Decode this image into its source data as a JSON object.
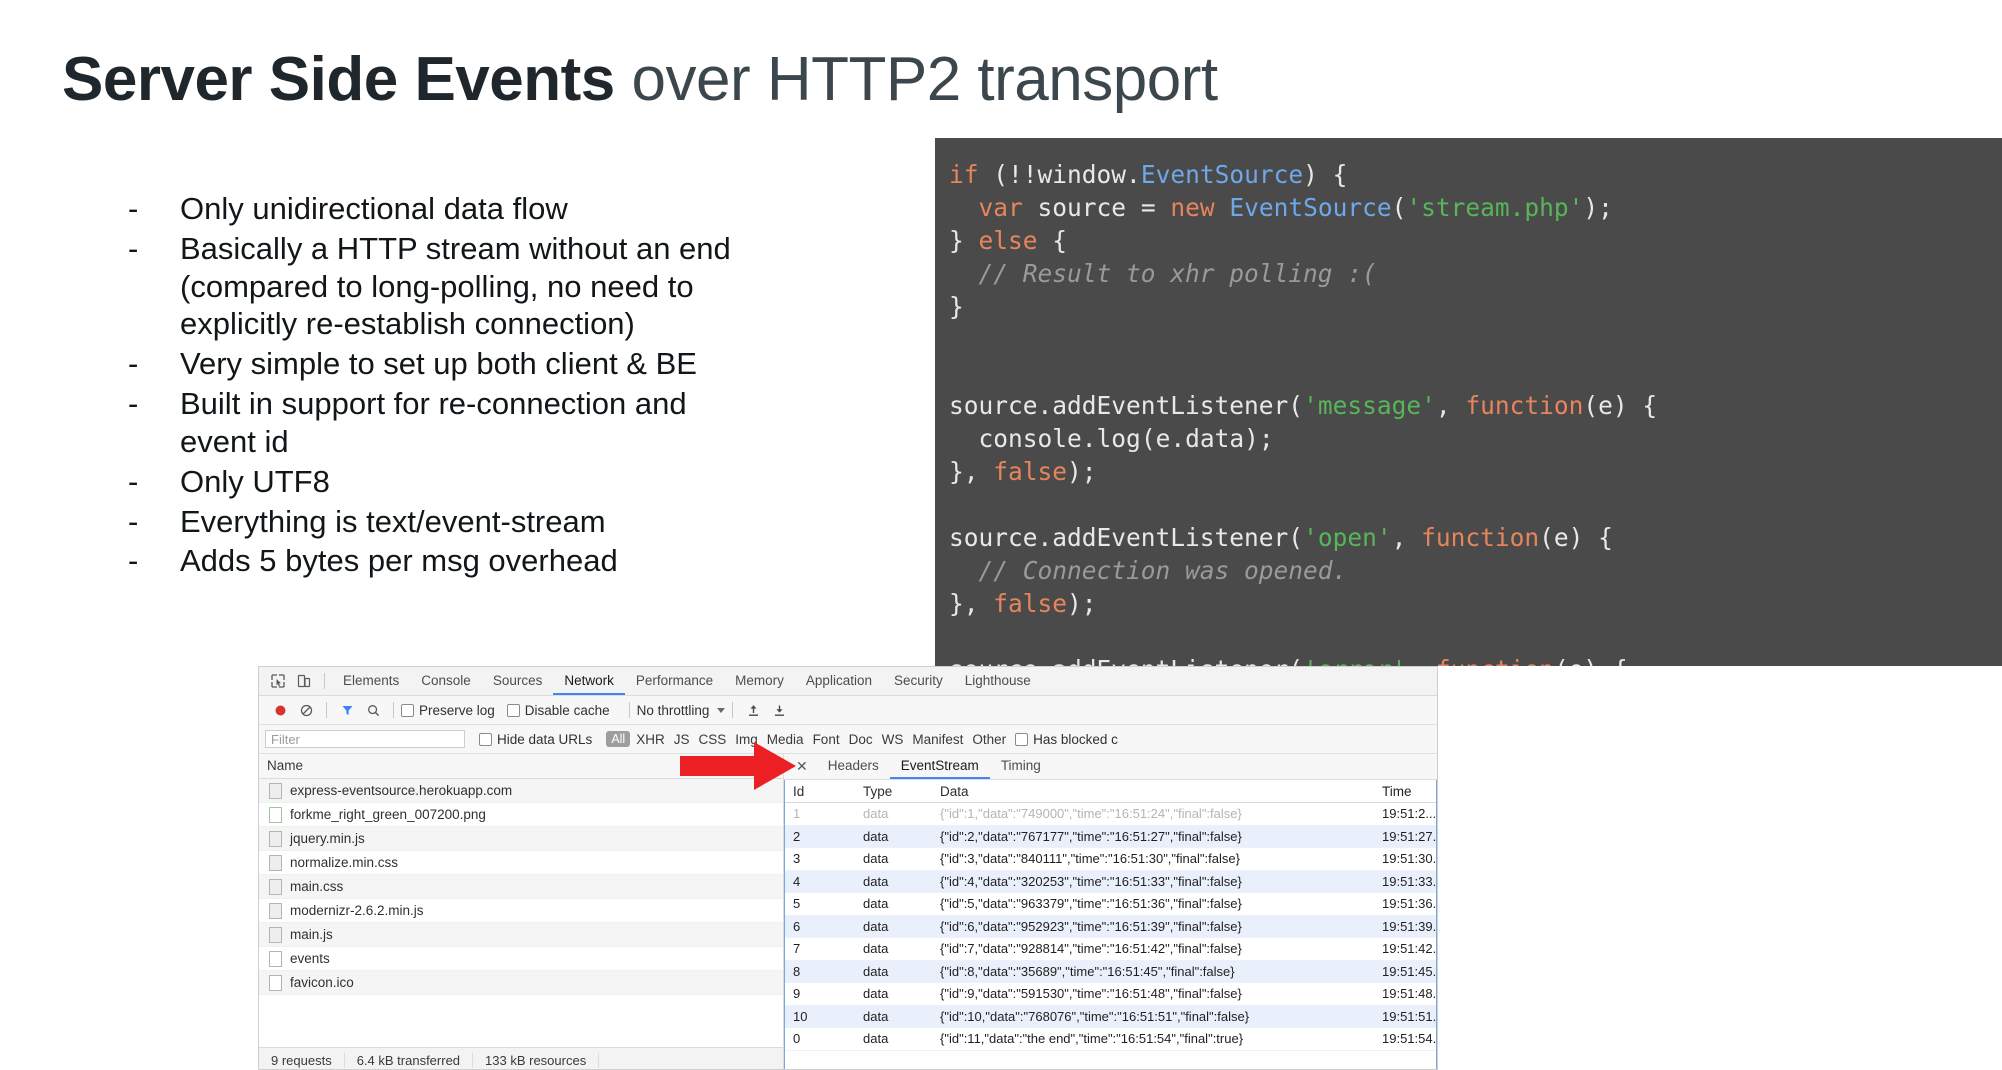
{
  "slide": {
    "title_bold": "Server Side Events",
    "title_light": " over HTTP2 transport",
    "bullets": [
      {
        "mark": "-",
        "text": "Only unidirectional data flow"
      },
      {
        "mark": "-",
        "text": "Basically a HTTP stream without an end\n(compared to long-polling, no need to\nexplicitly re-establish connection)"
      },
      {
        "mark": "-",
        "text": "Very simple to set up both client & BE"
      },
      {
        "mark": "-",
        "text": "Built in support for re-connection and\nevent id"
      },
      {
        "mark": "-",
        "text": "Only UTF8"
      },
      {
        "mark": "-",
        "text": "Everything is text/event-stream"
      },
      {
        "mark": "-",
        "text": "Adds 5 bytes per msg overhead"
      }
    ]
  },
  "code": {
    "language": "javascript",
    "background": "#4a4a4a",
    "colors": {
      "keyword": "#e8845c",
      "class": "#6fa8e8",
      "string": "#58b55a",
      "comment": "#9a9a9a",
      "plain": "#e8e8e8"
    },
    "text": "if (!!window.EventSource) {\n  var source = new EventSource('stream.php');\n} else {\n  // Result to xhr polling :(\n}\n\n\nsource.addEventListener('message', function(e) {\n  console.log(e.data);\n}, false);\n\nsource.addEventListener('open', function(e) {\n  // Connection was opened.\n}, false);\n\nsource.addEventListener('error', function(e) {\n  if (e.readyState == EventSource.CLOSED) {\n    // Connection was closed.\n  }\n}, false);"
  },
  "devtools": {
    "panel_tabs": [
      {
        "label": "Elements",
        "active": false
      },
      {
        "label": "Console",
        "active": false
      },
      {
        "label": "Sources",
        "active": false
      },
      {
        "label": "Network",
        "active": true
      },
      {
        "label": "Performance",
        "active": false
      },
      {
        "label": "Memory",
        "active": false
      },
      {
        "label": "Application",
        "active": false
      },
      {
        "label": "Security",
        "active": false
      },
      {
        "label": "Lighthouse",
        "active": false
      }
    ],
    "toolbar": {
      "record_icon": "record-icon",
      "clear_icon": "clear-icon",
      "filter_icon": "filter-icon",
      "search_icon": "search-icon",
      "preserve_log": "Preserve log",
      "disable_cache": "Disable cache",
      "throttling": "No throttling",
      "import_icon": "import-har-icon",
      "export_icon": "export-har-icon"
    },
    "filterbar": {
      "filter_placeholder": "Filter",
      "hide_data_urls": "Hide data URLs",
      "all_pill": "All",
      "types": [
        "XHR",
        "JS",
        "CSS",
        "Img",
        "Media",
        "Font",
        "Doc",
        "WS",
        "Manifest",
        "Other"
      ],
      "has_blocked": "Has blocked c"
    },
    "requests": {
      "column_header": "Name",
      "items": [
        {
          "name": "express-eventsource.herokuapp.com",
          "icon": "doc-icon"
        },
        {
          "name": "forkme_right_green_007200.png",
          "icon": "image-icon"
        },
        {
          "name": "jquery.min.js",
          "icon": "script-icon"
        },
        {
          "name": "normalize.min.css",
          "icon": "stylesheet-icon"
        },
        {
          "name": "main.css",
          "icon": "stylesheet-icon"
        },
        {
          "name": "modernizr-2.6.2.min.js",
          "icon": "script-icon"
        },
        {
          "name": "main.js",
          "icon": "script-icon"
        },
        {
          "name": "events",
          "icon": "plain-icon"
        },
        {
          "name": "favicon.ico",
          "icon": "plain-icon"
        }
      ]
    },
    "statusbar": {
      "requests": "9 requests",
      "transferred": "6.4 kB transferred",
      "resources": "133 kB resources"
    },
    "detail_tabs": [
      {
        "label": "Headers",
        "active": false
      },
      {
        "label": "EventStream",
        "active": true
      },
      {
        "label": "Timing",
        "active": false
      }
    ],
    "event_stream": {
      "columns": [
        "Id",
        "Type",
        "Data",
        "Time"
      ],
      "rows": [
        {
          "id": "1",
          "type": "data",
          "data": "{\"id\":1,\"data\":\"749000\",\"time\":\"16:51:24\",\"final\":false}",
          "time": "19:51:2...",
          "partial": true
        },
        {
          "id": "2",
          "type": "data",
          "data": "{\"id\":2,\"data\":\"767177\",\"time\":\"16:51:27\",\"final\":false}",
          "time": "19:51:27..",
          "partial": false
        },
        {
          "id": "3",
          "type": "data",
          "data": "{\"id\":3,\"data\":\"840111\",\"time\":\"16:51:30\",\"final\":false}",
          "time": "19:51:30..",
          "partial": false
        },
        {
          "id": "4",
          "type": "data",
          "data": "{\"id\":4,\"data\":\"320253\",\"time\":\"16:51:33\",\"final\":false}",
          "time": "19:51:33..",
          "partial": false
        },
        {
          "id": "5",
          "type": "data",
          "data": "{\"id\":5,\"data\":\"963379\",\"time\":\"16:51:36\",\"final\":false}",
          "time": "19:51:36..",
          "partial": false
        },
        {
          "id": "6",
          "type": "data",
          "data": "{\"id\":6,\"data\":\"952923\",\"time\":\"16:51:39\",\"final\":false}",
          "time": "19:51:39..",
          "partial": false
        },
        {
          "id": "7",
          "type": "data",
          "data": "{\"id\":7,\"data\":\"928814\",\"time\":\"16:51:42\",\"final\":false}",
          "time": "19:51:42..",
          "partial": false
        },
        {
          "id": "8",
          "type": "data",
          "data": "{\"id\":8,\"data\":\"35689\",\"time\":\"16:51:45\",\"final\":false}",
          "time": "19:51:45..",
          "partial": false
        },
        {
          "id": "9",
          "type": "data",
          "data": "{\"id\":9,\"data\":\"591530\",\"time\":\"16:51:48\",\"final\":false}",
          "time": "19:51:48..",
          "partial": false
        },
        {
          "id": "10",
          "type": "data",
          "data": "{\"id\":10,\"data\":\"768076\",\"time\":\"16:51:51\",\"final\":false}",
          "time": "19:51:51..",
          "partial": false
        },
        {
          "id": "0",
          "type": "data",
          "data": "{\"id\":11,\"data\":\"the end\",\"time\":\"16:51:54\",\"final\":true}",
          "time": "19:51:54..",
          "partial": false
        }
      ]
    },
    "annotation": {
      "arrow_color": "#ec2024",
      "arrow_icon": "red-arrow-icon"
    }
  }
}
